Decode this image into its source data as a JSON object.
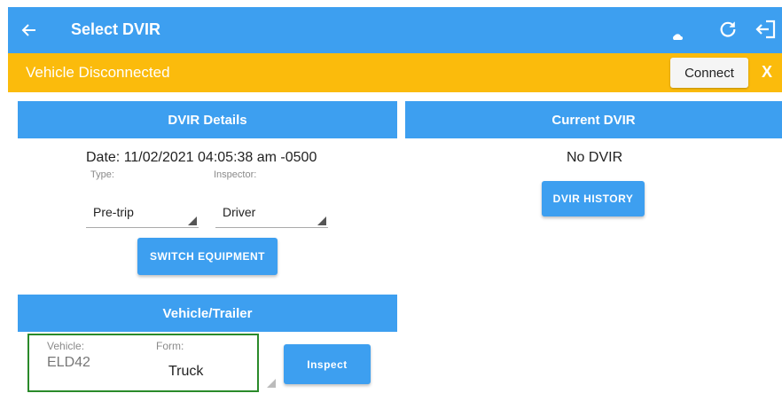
{
  "appbar": {
    "back_icon": "arrow-left-icon",
    "title": "Select DVIR",
    "refresh_icon": "refresh-icon",
    "logout_icon": "logout-icon",
    "color": "#3d9ff0"
  },
  "banner": {
    "message": "Vehicle Disconnected",
    "connect_label": "Connect",
    "close_label": "X",
    "color": "#fbbb0c"
  },
  "dvir_details": {
    "header": "DVIR Details",
    "date": "Date: 11/02/2021 04:05:38 am -0500",
    "type_label": "Type:",
    "type_value": "Pre-trip",
    "inspector_label": "Inspector:",
    "inspector_value": "Driver",
    "switch_equipment_label": "SWITCH EQUIPMENT"
  },
  "current_dvir": {
    "header": "Current DVIR",
    "status": "No DVIR",
    "history_label": "DVIR HISTORY"
  },
  "vehicle_trailer": {
    "header": "Vehicle/Trailer",
    "vehicle_label": "Vehicle:",
    "vehicle_value": "ELD42",
    "form_label": "Form:",
    "form_value": "Truck",
    "inspect_label": "Inspect"
  }
}
